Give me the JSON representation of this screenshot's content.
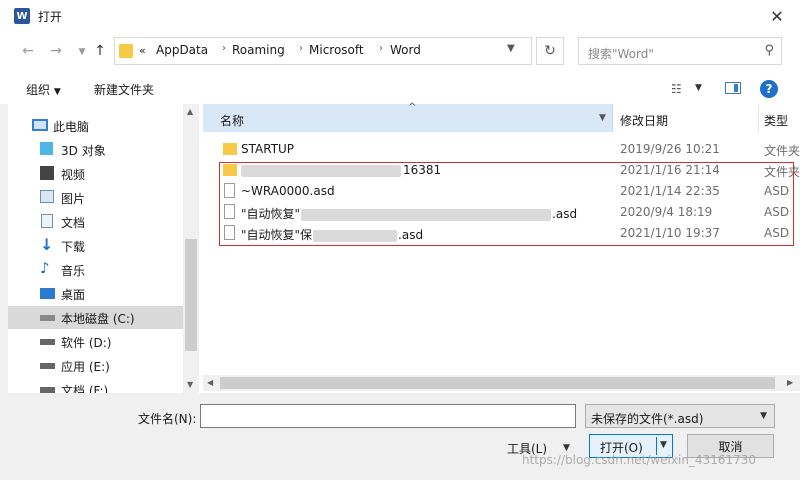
{
  "window": {
    "title": "打开",
    "app_icon": "W"
  },
  "nav": {
    "breadcrumb": [
      "AppData",
      "Roaming",
      "Microsoft",
      "Word"
    ],
    "overflow": "«",
    "search_placeholder": "搜索\"Word\""
  },
  "toolbar": {
    "organize": "组织",
    "new_folder": "新建文件夹"
  },
  "sidebar": {
    "items": [
      {
        "label": "此电脑",
        "icon": "computer-icon"
      },
      {
        "label": "3D 对象",
        "icon": "cube-icon"
      },
      {
        "label": "视频",
        "icon": "video-icon"
      },
      {
        "label": "图片",
        "icon": "picture-icon"
      },
      {
        "label": "文档",
        "icon": "document-icon"
      },
      {
        "label": "下载",
        "icon": "download-icon"
      },
      {
        "label": "音乐",
        "icon": "music-icon"
      },
      {
        "label": "桌面",
        "icon": "desktop-icon"
      },
      {
        "label": "本地磁盘 (C:)",
        "icon": "drive-icon"
      },
      {
        "label": "软件 (D:)",
        "icon": "drive-icon"
      },
      {
        "label": "应用 (E:)",
        "icon": "drive-icon"
      },
      {
        "label": "文档 (F:)",
        "icon": "drive-icon"
      }
    ]
  },
  "columns": {
    "name": "名称",
    "date": "修改日期",
    "type": "类型"
  },
  "files": [
    {
      "name": "STARTUP",
      "date": "2019/9/26 10:21",
      "type": "文件夹",
      "kind": "folder"
    },
    {
      "name": "16381",
      "date": "2021/1/16 21:14",
      "type": "文件夹",
      "kind": "folder"
    },
    {
      "name": "~WRA0000.asd",
      "date": "2021/1/14 22:35",
      "type": "ASD",
      "kind": "file"
    },
    {
      "name": "\"自动恢复\"",
      "name_suffix": ".asd",
      "date": "2020/9/4 18:19",
      "type": "ASD",
      "kind": "file"
    },
    {
      "name": "\"自动恢复\"保",
      "name_suffix": ".asd",
      "date": "2021/1/10 19:37",
      "type": "ASD",
      "kind": "file"
    }
  ],
  "bottom": {
    "filename_label": "文件名(N):",
    "filename_value": "",
    "filetype": "未保存的文件(*.asd)",
    "tools": "工具(L)",
    "open": "打开(O)",
    "cancel": "取消"
  },
  "watermark": "https://blog.csdn.net/weixin_43161730",
  "colors": {
    "highlight_border": "#d32f2f",
    "selection": "#d9d9d9",
    "header_active": "#d9e8f7",
    "accent": "#0078d7"
  }
}
